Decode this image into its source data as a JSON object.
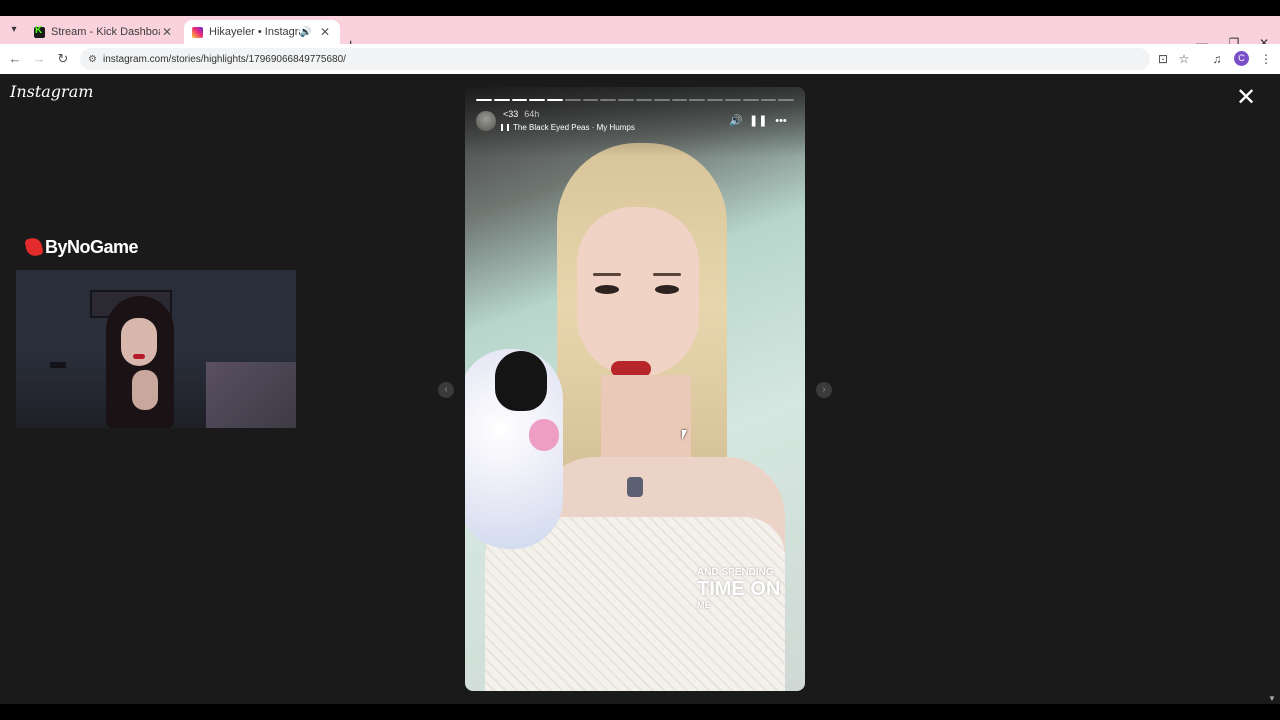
{
  "browser": {
    "tabs": [
      {
        "title": "Stream - Kick Dashboard",
        "favicon": "kick-icon",
        "active": false
      },
      {
        "title": "Hikayeler • Instagram",
        "favicon": "instagram-icon",
        "active": true,
        "audio": true
      }
    ],
    "url": "instagram.com/stories/highlights/17969066849775680/",
    "profile_initial": "C",
    "colors": {
      "tabstrip": "#f9d2dd",
      "profile": "#7b4fc9"
    }
  },
  "instagram": {
    "logo": "Instagram",
    "story": {
      "username": "<33",
      "time_ago": "64h",
      "music": "The Black Eyed Peas · My Humps",
      "lyrics": [
        "AND SPENDING",
        "TIME ON",
        "ME"
      ],
      "progress_segments_total": 18,
      "progress_segments_done": 5
    }
  },
  "overlay": {
    "brand": "ByNoGame"
  }
}
